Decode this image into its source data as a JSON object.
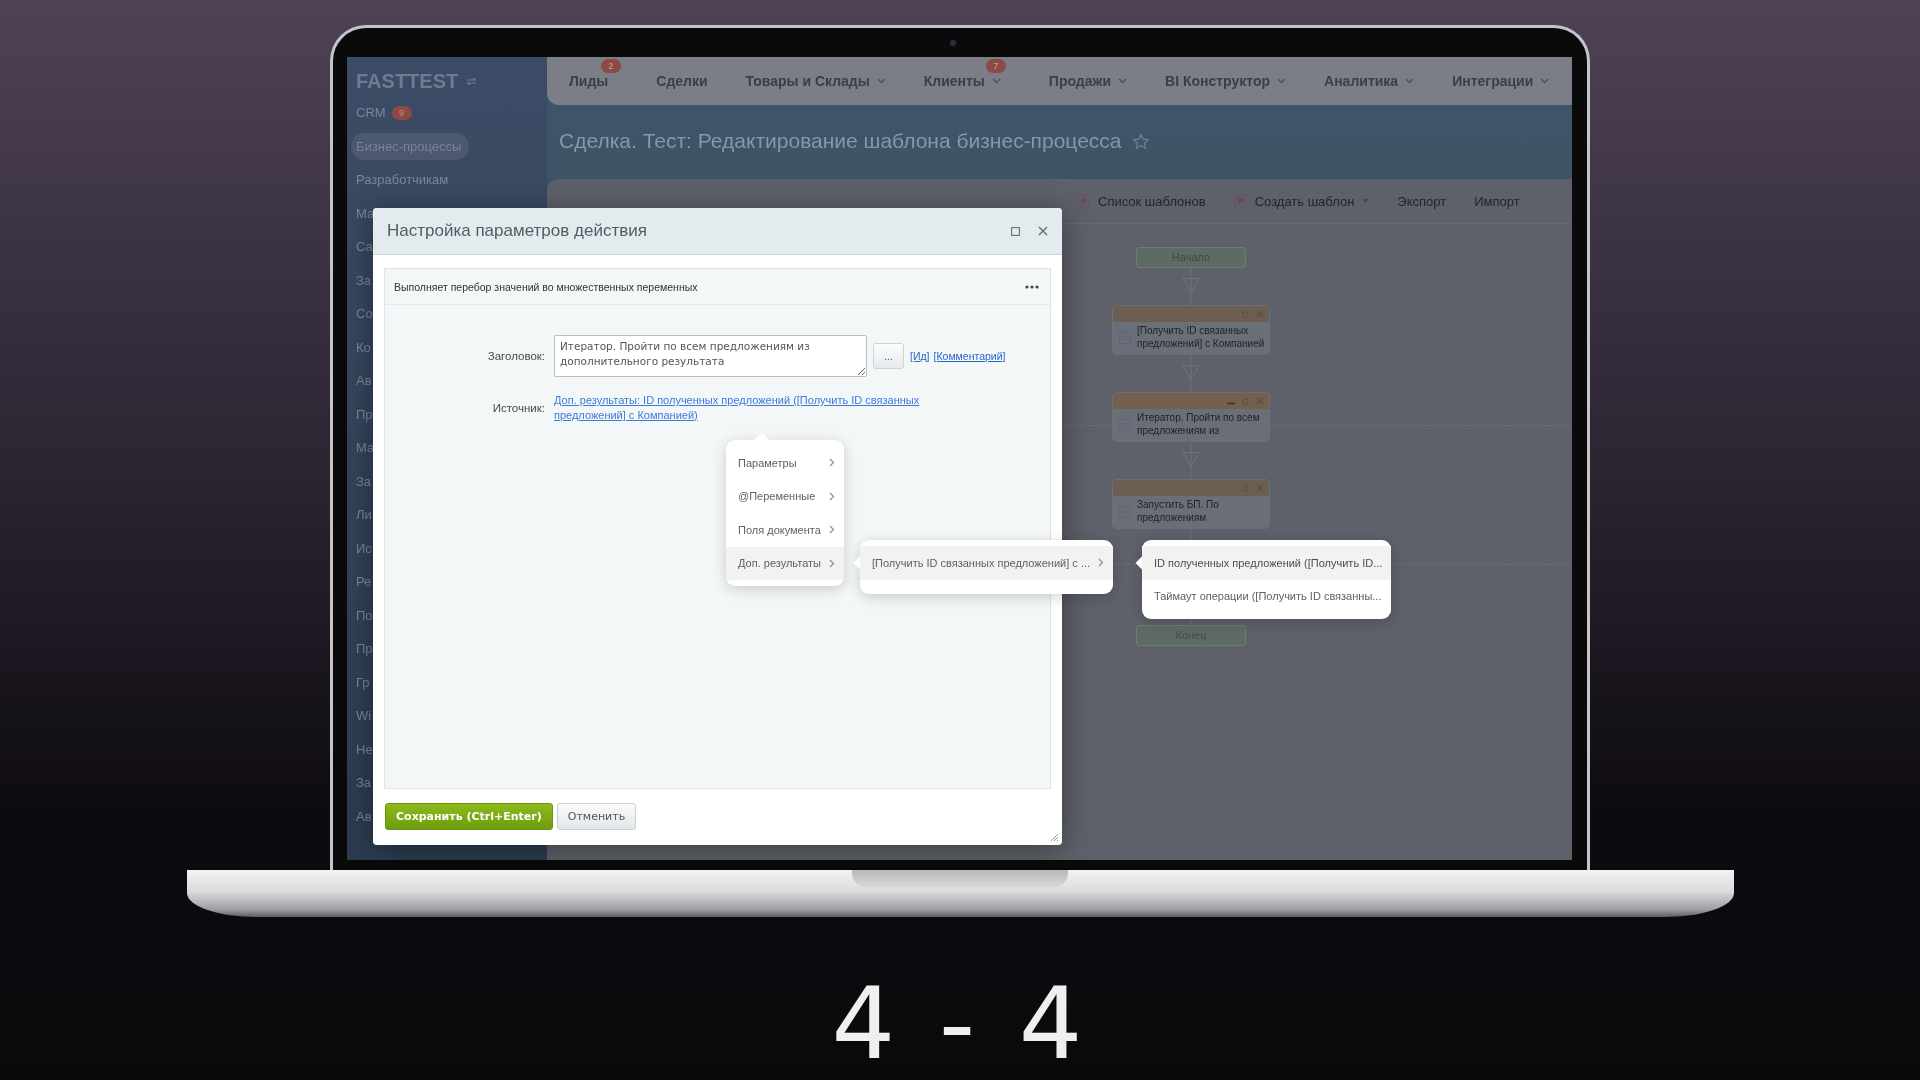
{
  "logo": {
    "text": "FASTTEST"
  },
  "sidebar": {
    "items": [
      {
        "label": "CRM",
        "badge": "9",
        "selected": false
      },
      {
        "label": "Бизнес-процессы",
        "selected": true
      },
      {
        "label": "Разработчикам",
        "selected": false
      },
      {
        "label": "Ма",
        "selected": false
      },
      {
        "label": "Са",
        "selected": false
      },
      {
        "label": "За",
        "selected": false
      },
      {
        "label": "Со",
        "selected": false
      },
      {
        "label": "Ко",
        "selected": false
      },
      {
        "label": "Ав",
        "selected": false
      },
      {
        "label": "Пр",
        "selected": false
      },
      {
        "label": "Ма",
        "selected": false
      },
      {
        "label": "За",
        "selected": false
      },
      {
        "label": "Ли",
        "selected": false
      },
      {
        "label": "Ис",
        "selected": false
      },
      {
        "label": "Ре",
        "selected": false
      },
      {
        "label": "По",
        "selected": false
      },
      {
        "label": "Пр",
        "selected": false
      },
      {
        "label": "Гр",
        "selected": false
      },
      {
        "label": "Wi",
        "selected": false
      },
      {
        "label": "Не",
        "selected": false
      },
      {
        "label": "За",
        "selected": false
      },
      {
        "label": "Ав",
        "selected": false
      }
    ]
  },
  "top_nav": {
    "items": [
      {
        "label": "Лиды",
        "badge": "2",
        "dropdown": false
      },
      {
        "label": "Сделки",
        "dropdown": false
      },
      {
        "label": "Товары и Склады",
        "dropdown": true
      },
      {
        "label": "Клиенты",
        "badge": "7",
        "dropdown": true
      },
      {
        "label": "Продажи",
        "dropdown": true
      },
      {
        "label": "BI Конструктор",
        "dropdown": true
      },
      {
        "label": "Аналитика",
        "dropdown": true
      },
      {
        "label": "Интеграции",
        "dropdown": true
      }
    ]
  },
  "page_title": "Сделка. Тест: Редактирование шаблона бизнес-процесса",
  "toolbar": {
    "items": [
      {
        "label": "Список шаблонов",
        "kind": "icon"
      },
      {
        "label": "Создать шаблон",
        "kind": "dropdown"
      },
      {
        "label": "Экспорт",
        "kind": "plain"
      },
      {
        "label": "Импорт",
        "kind": "plain"
      }
    ]
  },
  "flowchart": {
    "nodes": [
      {
        "kind": "terminal",
        "label": "Начало"
      },
      {
        "kind": "action",
        "label": "[Получить ID связанных предложений] с Компанией",
        "collapsible": false
      },
      {
        "kind": "action",
        "label": "Итератор. Пройти по всем предложениям из",
        "collapsible": true
      },
      {
        "kind": "action",
        "label": "Запустить БП. По предложениям",
        "collapsible": false
      },
      {
        "kind": "terminal",
        "label": "Конец"
      }
    ]
  },
  "dialog": {
    "title": "Настройка параметров действия",
    "description": "Выполняет перебор значений во множественных переменных",
    "fields": [
      {
        "kind": "textarea",
        "label": "Заголовок:",
        "value": "Итератор. Пройти по всем предложениям из дополнительного результата"
      },
      {
        "kind": "link",
        "label": "Источник:",
        "value": "Доп. результаты: ID полученных предложений ([Получить ID связанных предложений] с Компанией)"
      }
    ],
    "picker_button": "...",
    "extra_links": [
      "[Ид]",
      "[Комментарий]"
    ],
    "menus": [
      {
        "items": [
          {
            "label": "Параметры",
            "selected": false
          },
          {
            "label": "@Переменные",
            "selected": false
          },
          {
            "label": "Поля документа",
            "selected": false
          },
          {
            "label": "Доп. результаты",
            "selected": true
          }
        ]
      },
      {
        "items": [
          {
            "label": "[Получить ID связанных предложений] с ...",
            "selected": true
          }
        ]
      },
      {
        "items": [
          {
            "label": "ID полученных предложений ([Получить ID...",
            "selected": true
          },
          {
            "label": "Таймаут операции ([Получить ID связанны...",
            "selected": false
          }
        ]
      }
    ],
    "buttons": [
      {
        "label": "Сохранить (Ctrl+Enter)",
        "kind": "primary"
      },
      {
        "label": "Отменить",
        "kind": "secondary"
      }
    ]
  },
  "caption": "4 - 4"
}
